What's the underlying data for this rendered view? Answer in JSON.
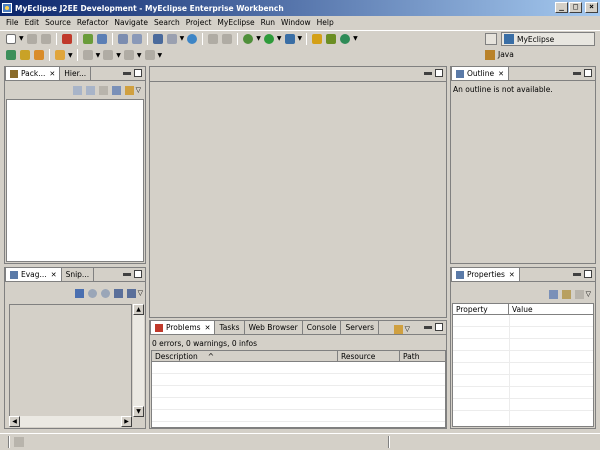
{
  "window": {
    "title": "MyEclipse J2EE Development - MyEclipse Enterprise Workbench",
    "controls": [
      "_",
      "□",
      "×"
    ]
  },
  "menu": [
    "File",
    "Edit",
    "Source",
    "Refactor",
    "Navigate",
    "Search",
    "Project",
    "MyEclipse",
    "Run",
    "Window",
    "Help"
  ],
  "perspectives": {
    "active": "MyEclipse",
    "other": "Java"
  },
  "left_top_panel": {
    "tabs": [
      "Pack...",
      "Hier..."
    ]
  },
  "left_bottom_panel": {
    "tabs": [
      "Evag...",
      "Snip..."
    ]
  },
  "outline_panel": {
    "tab": "Outline",
    "message": "An outline is not available."
  },
  "properties_panel": {
    "tab": "Properties",
    "columns": [
      "Property",
      "Value"
    ]
  },
  "problems_panel": {
    "tabs": [
      "Problems",
      "Tasks",
      "Web Browser",
      "Console",
      "Servers"
    ],
    "summary": "0 errors, 0 warnings, 0 infos",
    "columns": [
      "Description",
      "Resource",
      "Path"
    ],
    "sort_indicator": "^"
  },
  "colors": {
    "title_start": "#0a246a",
    "title_end": "#a6caf0",
    "chrome": "#d4d0c8"
  }
}
